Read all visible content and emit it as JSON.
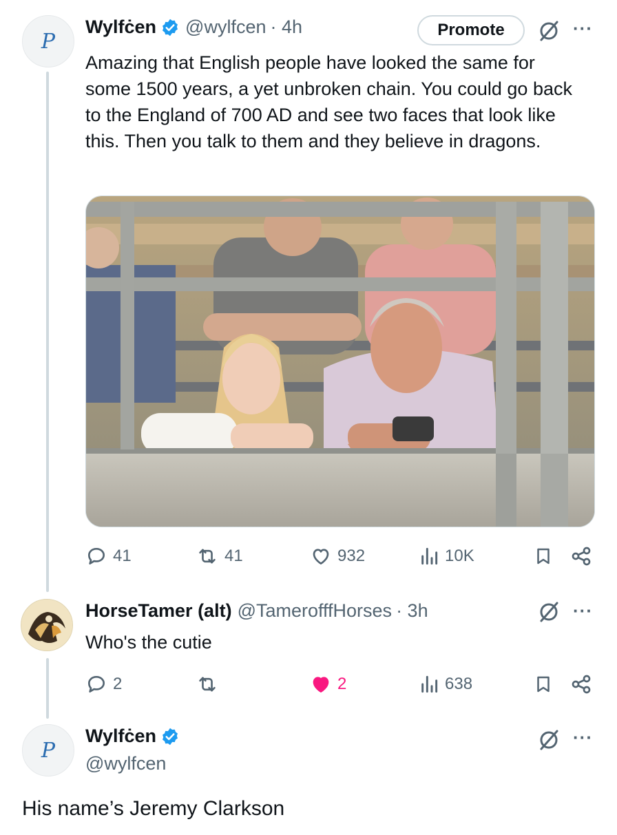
{
  "tweet1": {
    "name": "Wylfċen",
    "handle": "@wylfcen",
    "time": "· 4h",
    "promote_label": "Promote",
    "avatar_letter": "P",
    "text": "Amazing that English people have looked the same for some 1500 years, a yet unbroken chain. You could go back to the England of 700 AD and see two faces that look like this. Then you talk to them and they believe in dragons.",
    "image_alt": "Photo of a young woman and an older man leaning on a metal gate at a livestock auction, with men standing behind them",
    "actions": {
      "replies": "41",
      "reposts": "41",
      "likes": "932",
      "views": "10K"
    }
  },
  "tweet2": {
    "name": "HorseTamer (alt)",
    "handle": "@TamerofffHorses",
    "time": "· 3h",
    "text": "Who's the cutie",
    "actions": {
      "replies": "2",
      "reposts": "",
      "likes": "2",
      "views": "638"
    },
    "like_color": "#f91880"
  },
  "tweet3": {
    "name": "Wylfċen",
    "handle": "@wylfcen",
    "avatar_letter": "P",
    "text": "His name’s Jeremy Clarkson"
  },
  "colors": {
    "verified": "#1d9bf0",
    "secondary_text": "#536471",
    "thread_line": "#cfd9de"
  },
  "icons": [
    "verified-badge-icon",
    "grok-icon",
    "more-icon",
    "reply-icon",
    "repost-icon",
    "like-icon",
    "views-icon",
    "bookmark-icon",
    "share-icon"
  ]
}
